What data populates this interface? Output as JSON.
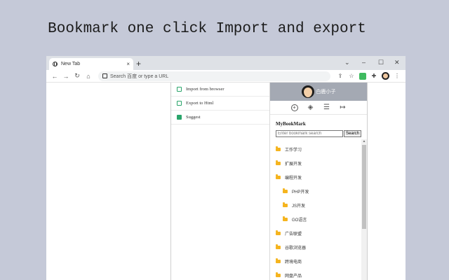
{
  "headline": "Bookmark one click Import and export",
  "browser": {
    "tab_title": "New Tab",
    "tab_close": "×",
    "new_tab": "+",
    "window_controls": [
      "⌄",
      "–",
      "☐",
      "✕"
    ],
    "nav": [
      "←",
      "→",
      "↻",
      "⌂"
    ],
    "omnibox_placeholder": "Search 百度 or type a URL",
    "toolbar_icons": [
      "⇪",
      "☆",
      "✚",
      "⋮"
    ]
  },
  "menu": {
    "items": [
      {
        "label": "Import from browser",
        "icon": "import-icon"
      },
      {
        "label": "Export to Html",
        "icon": "export-icon"
      },
      {
        "label": "Suggest",
        "icon": "suggest-icon"
      }
    ]
  },
  "panel": {
    "username": "白鹿小子",
    "icons": [
      "add-icon",
      "layers-icon",
      "menu-lines-icon",
      "logout-icon"
    ],
    "icon_glyphs": [
      "+",
      "◈",
      "☰",
      "↦"
    ],
    "list_title": "MyBookMark",
    "search_placeholder": "Enter bookmark search",
    "search_button": "Search",
    "tree": [
      {
        "label": "工作学习",
        "level": 0
      },
      {
        "label": "扩展开发",
        "level": 0
      },
      {
        "label": "编程开发",
        "level": 0
      },
      {
        "label": "PHP开发",
        "level": 1
      },
      {
        "label": "JS开发",
        "level": 1
      },
      {
        "label": "GO语言",
        "level": 1
      },
      {
        "label": "广告联盟",
        "level": 0
      },
      {
        "label": "谷歌浏览器",
        "level": 0
      },
      {
        "label": "跨境电商",
        "level": 0
      },
      {
        "label": "网盘产品",
        "level": 0
      }
    ]
  },
  "colors": {
    "page_bg": "#c5c9d8",
    "panel_header": "#a4a9b3",
    "accent_green": "#2aa56b",
    "folder": "#f5b41e"
  }
}
